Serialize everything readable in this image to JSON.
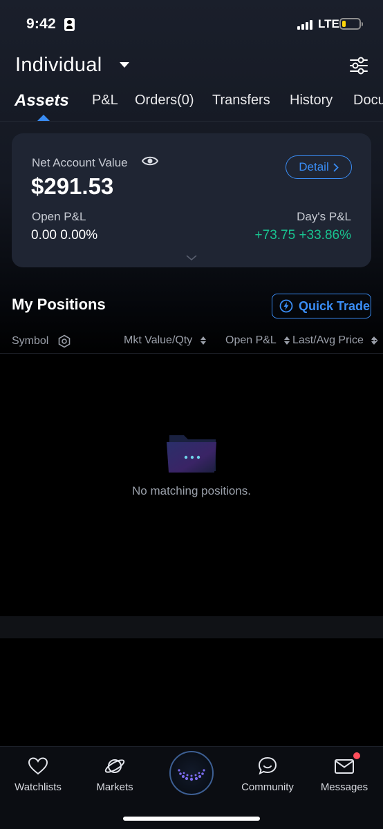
{
  "status_bar": {
    "time": "9:42",
    "network": "LTE"
  },
  "header": {
    "account_name": "Individual"
  },
  "tabs": [
    {
      "label": "Assets",
      "active": true
    },
    {
      "label": "P&L"
    },
    {
      "label": "Orders(0)"
    },
    {
      "label": "Transfers"
    },
    {
      "label": "History"
    },
    {
      "label": "Docu"
    }
  ],
  "summary": {
    "net_label": "Net Account Value",
    "net_value": "$291.53",
    "detail_label": "Detail",
    "open_pl_label": "Open P&L",
    "open_pl_value": "0.00 0.00%",
    "days_pl_label": "Day's P&L",
    "days_pl_value": "+73.75 +33.86%",
    "positive_color": "#19c390",
    "accent_color": "#3a8df5"
  },
  "positions": {
    "title": "My Positions",
    "quick_trade_label": "Quick Trade",
    "columns": [
      "Symbol",
      "Mkt Value/Qty",
      "Open P&L",
      "Last/Avg Price"
    ],
    "more_columns": "»",
    "empty_text": "No matching positions."
  },
  "bottom_nav": [
    {
      "label": "Watchlists",
      "icon": "heart-icon"
    },
    {
      "label": "Markets",
      "icon": "planet-icon"
    },
    {
      "label": "",
      "icon": "logo-icon"
    },
    {
      "label": "Community",
      "icon": "chat-bubble-icon"
    },
    {
      "label": "Messages",
      "icon": "envelope-icon",
      "badge": true
    }
  ]
}
